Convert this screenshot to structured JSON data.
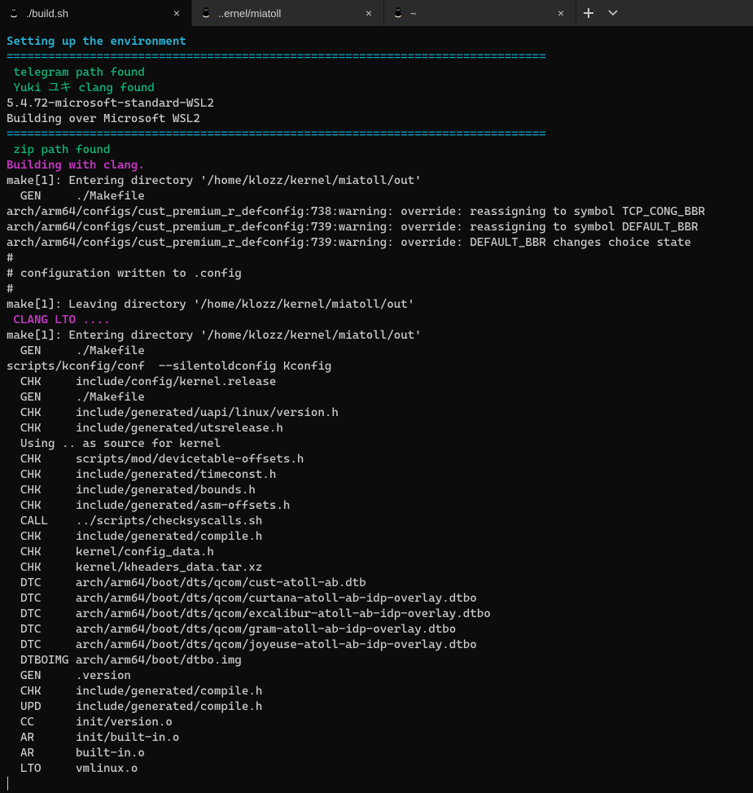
{
  "tabs": [
    {
      "label": "./build.sh",
      "active": true
    },
    {
      "label": "..ernel/miatoll",
      "active": false
    },
    {
      "label": "~",
      "active": false
    }
  ],
  "colors": {
    "bg": "#0c0c0c",
    "fg": "#cccccc",
    "cyan": "#11a8cd",
    "green": "#0dbc79",
    "magenta": "#c838c6",
    "tabbar": "#2b2b2b"
  },
  "terminal": {
    "lines": [
      {
        "c": "cyanb",
        "t": "Setting up the environment"
      },
      {
        "c": "cyan",
        "t": "=============================================================================="
      },
      {
        "c": "green",
        "t": " telegram path found"
      },
      {
        "c": "green",
        "t": " Yuki ユキ clang found"
      },
      {
        "c": "white",
        "t": "5.4.72-microsoft-standard-WSL2"
      },
      {
        "c": "white",
        "t": "Building over Microsoft WSL2"
      },
      {
        "c": "cyan",
        "t": "=============================================================================="
      },
      {
        "c": "green",
        "t": " zip path found"
      },
      {
        "c": "mag",
        "t": "Building with clang."
      },
      {
        "c": "white",
        "t": "make[1]: Entering directory '/home/klozz/kernel/miatoll/out'"
      },
      {
        "c": "white",
        "t": "  GEN     ./Makefile"
      },
      {
        "c": "white",
        "t": "arch/arm64/configs/cust_premium_r_defconfig:738:warning: override: reassigning to symbol TCP_CONG_BBR"
      },
      {
        "c": "white",
        "t": "arch/arm64/configs/cust_premium_r_defconfig:739:warning: override: reassigning to symbol DEFAULT_BBR"
      },
      {
        "c": "white",
        "t": "arch/arm64/configs/cust_premium_r_defconfig:739:warning: override: DEFAULT_BBR changes choice state"
      },
      {
        "c": "white",
        "t": "#"
      },
      {
        "c": "white",
        "t": "# configuration written to .config"
      },
      {
        "c": "white",
        "t": "#"
      },
      {
        "c": "white",
        "t": "make[1]: Leaving directory '/home/klozz/kernel/miatoll/out'"
      },
      {
        "c": "mag",
        "t": " CLANG LTO ...."
      },
      {
        "c": "white",
        "t": "make[1]: Entering directory '/home/klozz/kernel/miatoll/out'"
      },
      {
        "c": "white",
        "t": "  GEN     ./Makefile"
      },
      {
        "c": "white",
        "t": "scripts/kconfig/conf  --silentoldconfig Kconfig"
      },
      {
        "c": "white",
        "t": "  CHK     include/config/kernel.release"
      },
      {
        "c": "white",
        "t": "  GEN     ./Makefile"
      },
      {
        "c": "white",
        "t": "  CHK     include/generated/uapi/linux/version.h"
      },
      {
        "c": "white",
        "t": "  CHK     include/generated/utsrelease.h"
      },
      {
        "c": "white",
        "t": "  Using .. as source for kernel"
      },
      {
        "c": "white",
        "t": "  CHK     scripts/mod/devicetable-offsets.h"
      },
      {
        "c": "white",
        "t": "  CHK     include/generated/timeconst.h"
      },
      {
        "c": "white",
        "t": "  CHK     include/generated/bounds.h"
      },
      {
        "c": "white",
        "t": "  CHK     include/generated/asm-offsets.h"
      },
      {
        "c": "white",
        "t": "  CALL    ../scripts/checksyscalls.sh"
      },
      {
        "c": "white",
        "t": "  CHK     include/generated/compile.h"
      },
      {
        "c": "white",
        "t": "  CHK     kernel/config_data.h"
      },
      {
        "c": "white",
        "t": "  CHK     kernel/kheaders_data.tar.xz"
      },
      {
        "c": "white",
        "t": "  DTC     arch/arm64/boot/dts/qcom/cust-atoll-ab.dtb"
      },
      {
        "c": "white",
        "t": "  DTC     arch/arm64/boot/dts/qcom/curtana-atoll-ab-idp-overlay.dtbo"
      },
      {
        "c": "white",
        "t": "  DTC     arch/arm64/boot/dts/qcom/excalibur-atoll-ab-idp-overlay.dtbo"
      },
      {
        "c": "white",
        "t": "  DTC     arch/arm64/boot/dts/qcom/gram-atoll-ab-idp-overlay.dtbo"
      },
      {
        "c": "white",
        "t": "  DTC     arch/arm64/boot/dts/qcom/joyeuse-atoll-ab-idp-overlay.dtbo"
      },
      {
        "c": "white",
        "t": "  DTBOIMG arch/arm64/boot/dtbo.img"
      },
      {
        "c": "white",
        "t": "  GEN     .version"
      },
      {
        "c": "white",
        "t": "  CHK     include/generated/compile.h"
      },
      {
        "c": "white",
        "t": "  UPD     include/generated/compile.h"
      },
      {
        "c": "white",
        "t": "  CC      init/version.o"
      },
      {
        "c": "white",
        "t": "  AR      init/built-in.o"
      },
      {
        "c": "white",
        "t": "  AR      built-in.o"
      },
      {
        "c": "white",
        "t": "  LTO     vmlinux.o"
      }
    ]
  }
}
